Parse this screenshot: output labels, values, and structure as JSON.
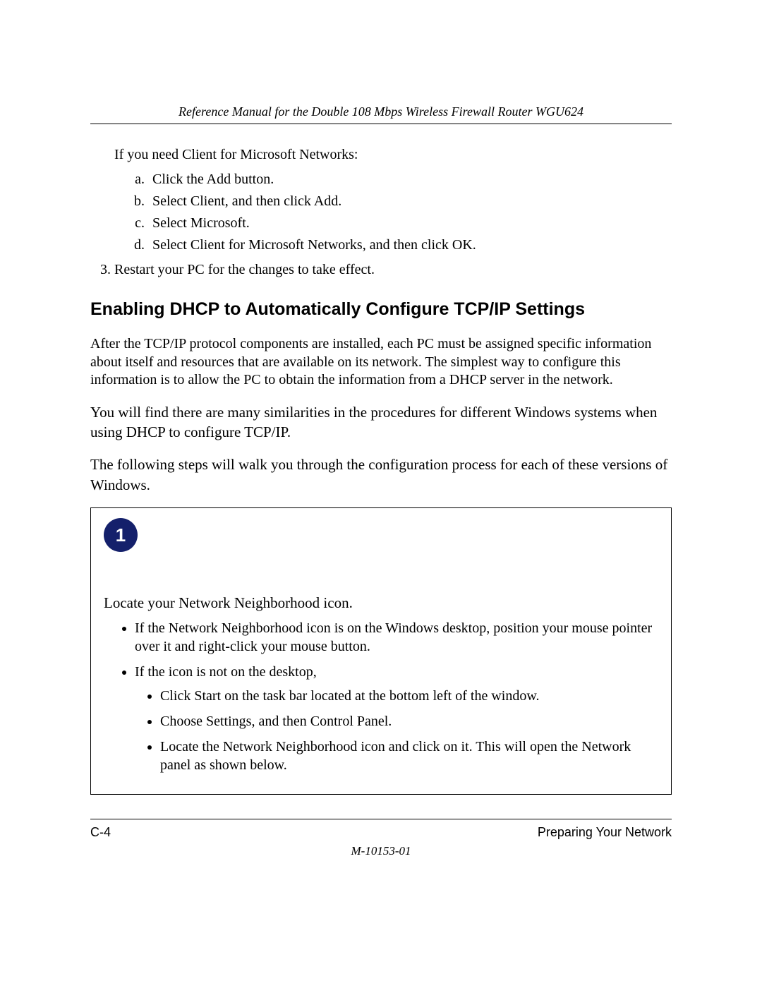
{
  "header": {
    "title": "Reference Manual for the Double 108 Mbps Wireless Firewall Router WGU624"
  },
  "intro": {
    "lead": "If you need Client for Microsoft Networks:",
    "steps": [
      "Click the Add button.",
      "Select Client, and then click Add.",
      "Select Microsoft.",
      "Select Client for Microsoft Networks, and then click OK."
    ],
    "restart": "Restart your PC for the changes to take effect."
  },
  "section": {
    "heading": "Enabling DHCP to Automatically Configure TCP/IP Settings",
    "p1": "After the TCP/IP protocol components are installed, each PC must be assigned specific information about itself and resources that are available on its network. The simplest way to configure this information is to allow the PC to obtain the information from a DHCP server in the network.",
    "p2": "You will find there are many similarities in the procedures for different Windows systems when using DHCP to configure TCP/IP.",
    "p3": "The following steps will walk you through the configuration process for each of these versions of Windows."
  },
  "stepbox": {
    "badge": "1",
    "intro": "Locate your Network Neighborhood icon.",
    "bullets": [
      "If the Network Neighborhood icon is on the Windows desktop, position your mouse pointer over it and right-click your mouse button.",
      "If the icon is not on the desktop,"
    ],
    "sub_bullets": [
      "Click Start on the task bar located at the bottom left of the window.",
      "Choose Settings, and then Control Panel.",
      "Locate the Network Neighborhood icon and click on it. This will open the Network panel as shown below."
    ]
  },
  "footer": {
    "page": "C-4",
    "chapter": "Preparing Your Network",
    "docid": "M-10153-01"
  }
}
